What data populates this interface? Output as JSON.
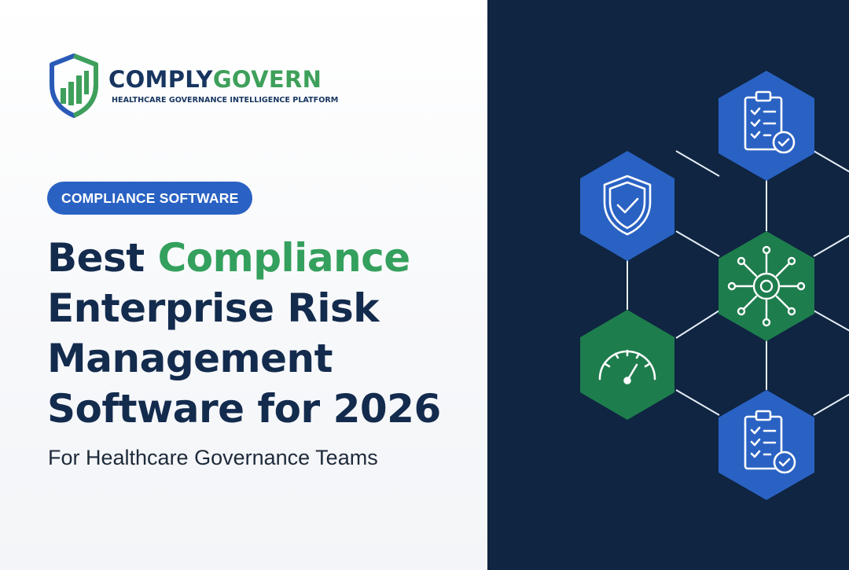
{
  "brand": {
    "name_part1": "COMPLY",
    "name_part2": "GOVERN",
    "tagline": "HEALTHCARE GOVERNANCE INTELLIGENCE PLATFORM"
  },
  "badge": {
    "label": "COMPLIANCE SOFTWARE"
  },
  "headline": {
    "line1_prefix": "Best",
    "line1_accent": "Compliance",
    "line2": "Enterprise Risk",
    "line3": "Management",
    "line4": "Software for 2026"
  },
  "subheadline": "For Healthcare Governance Teams",
  "graphic": {
    "hexagons": [
      {
        "icon": "clipboard-check-icon",
        "color": "#2a62c3"
      },
      {
        "icon": "shield-check-icon",
        "color": "#2a62c3"
      },
      {
        "icon": "gear-network-icon",
        "color": "#1e7d4d"
      },
      {
        "icon": "gauge-icon",
        "color": "#1e7d4d"
      },
      {
        "icon": "clipboard-check-icon",
        "color": "#2a62c3"
      }
    ]
  },
  "colors": {
    "navy": "#132b4d",
    "green": "#34a05d",
    "blue": "#2a62c3",
    "panel": "#0f2541"
  }
}
